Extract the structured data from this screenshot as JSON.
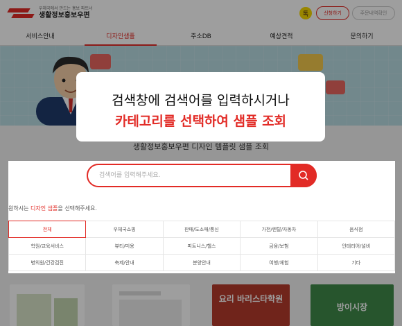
{
  "header": {
    "logo_tagline": "우체국에서 만드는 홍보 파트너",
    "logo_name": "생활정보홍보우편",
    "kakao_label": "톡",
    "btn_apply": "신청하기",
    "btn_history": "주문내역확인"
  },
  "nav": {
    "items": [
      {
        "label": "서비스안내"
      },
      {
        "label": "디자인샘플"
      },
      {
        "label": "주소DB"
      },
      {
        "label": "예상견적"
      },
      {
        "label": "문의하기"
      }
    ],
    "active_index": 1
  },
  "callout": {
    "line1": "검색창에 검색어를 입력하시거나",
    "line2": "카테고리를 선택하여 샘플 조회"
  },
  "main": {
    "heading": "생활정보홍보우편 디자인 템플릿 샘플 조회",
    "search_placeholder": "검색어를 입력해주세요.",
    "hint_before": "원하시는 ",
    "hint_accent": "디자인 샘플",
    "hint_after": "을 선택해주세요."
  },
  "categories": {
    "rows": [
      [
        "전체",
        "우체국쇼핑",
        "판매/도소매/통신",
        "가전/렌탈/자동차",
        "음식점"
      ],
      [
        "학원/교육서비스",
        "뷰티/미용",
        "피트니스/헬스",
        "금융/보험",
        "인테리어/설비"
      ],
      [
        "병의원/건강검진",
        "축제/안내",
        "분양안내",
        "여행/체험",
        "기타"
      ]
    ],
    "selected": "전체"
  },
  "thumbnails": {
    "t3_text": "요리 바리스타학원",
    "t4_text": "방이시장"
  },
  "colors": {
    "accent": "#e22b26",
    "hero_bg": "#b9dbe3"
  }
}
